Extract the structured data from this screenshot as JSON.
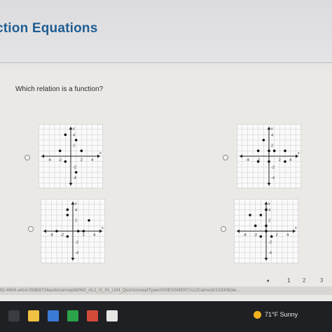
{
  "header": {
    "title": "ction Equations"
  },
  "question": {
    "text": "Which relation is a function?"
  },
  "graphs": [
    {
      "id": "a",
      "points": [
        [
          -1,
          4
        ],
        [
          1,
          3
        ],
        [
          -2,
          1
        ],
        [
          2,
          1
        ],
        [
          -1,
          -1
        ],
        [
          1,
          -3
        ]
      ]
    },
    {
      "id": "b",
      "points": [
        [
          -1,
          3
        ],
        [
          -2,
          1
        ],
        [
          0,
          1
        ],
        [
          1,
          1
        ],
        [
          3,
          1
        ],
        [
          -2,
          -1
        ],
        [
          0,
          -1
        ],
        [
          3,
          -1
        ]
      ]
    },
    {
      "id": "c",
      "points": [
        [
          -1,
          4
        ],
        [
          -1,
          3
        ],
        [
          3,
          2
        ],
        [
          -3,
          0
        ],
        [
          1,
          0
        ],
        [
          2,
          0
        ],
        [
          -1,
          -1
        ]
      ]
    },
    {
      "id": "d",
      "points": [
        [
          -3,
          3
        ],
        [
          -1,
          3
        ],
        [
          0,
          4
        ],
        [
          -2,
          1
        ],
        [
          0,
          1
        ],
        [
          -1,
          -1
        ],
        [
          1,
          -1
        ],
        [
          0,
          0
        ]
      ]
    }
  ],
  "axes": {
    "x_label": "x",
    "y_label": "y",
    "ticks": [
      "-4",
      "-2",
      "2",
      "4"
    ]
  },
  "pagination": {
    "prev": "◂",
    "pages": [
      "1",
      "2",
      "3"
    ]
  },
  "browser": {
    "url": "92-4654-a414-558b9724acdc/conceptId/NG_AL1_G_01_U04_Quiz/conceptType/ASSESSMENT/s12CalmoId/133308(be..."
  },
  "taskbar": {
    "weather": "71°F  Sunny"
  },
  "colors": {
    "heading": "#1f5d92",
    "accent": "#2f6ea5",
    "taskbar": "#1f2024"
  }
}
